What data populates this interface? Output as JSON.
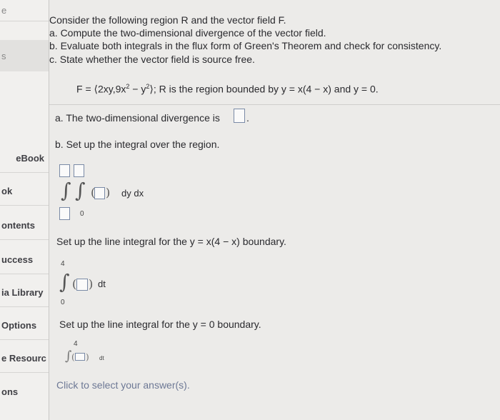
{
  "sidebar": {
    "items": [
      {
        "label": "e"
      },
      {
        "label": "s"
      },
      {
        "label": "eBook"
      },
      {
        "label": "ok"
      },
      {
        "label": "ontents"
      },
      {
        "label": "uccess"
      },
      {
        "label": "ia Library"
      },
      {
        "label": "Options"
      },
      {
        "label": "e Resourc"
      },
      {
        "label": "ons"
      }
    ]
  },
  "problem": {
    "intro": "Consider the following region R and the vector field F.",
    "part_a": "a. Compute the two-dimensional divergence of the vector field.",
    "part_b": "b. Evaluate both integrals in the flux form of Green's Theorem and check for consistency.",
    "part_c": "c. State whether the vector field is source free.",
    "field_lhs": "F = ⟨2xy,9x",
    "field_mid": " − y",
    "field_rhs": "⟩; R is the region bounded by y = x(4 − x) and y = 0.",
    "exp2": "2"
  },
  "answers": {
    "div_label": "a. The two-dimensional divergence is",
    "div_period": ".",
    "setup_label": "b. Set up the integral over the region.",
    "dydx": "dy dx",
    "lower_limit_inner": "0",
    "line1_label": "Set up the line integral for the y = x(4 − x) boundary.",
    "line1_upper": "4",
    "line1_lower": "0",
    "dt": "dt",
    "line2_label": "Set up the line integral for the y = 0 boundary.",
    "line2_upper": "4",
    "footer": "Click to select your answer(s)."
  }
}
